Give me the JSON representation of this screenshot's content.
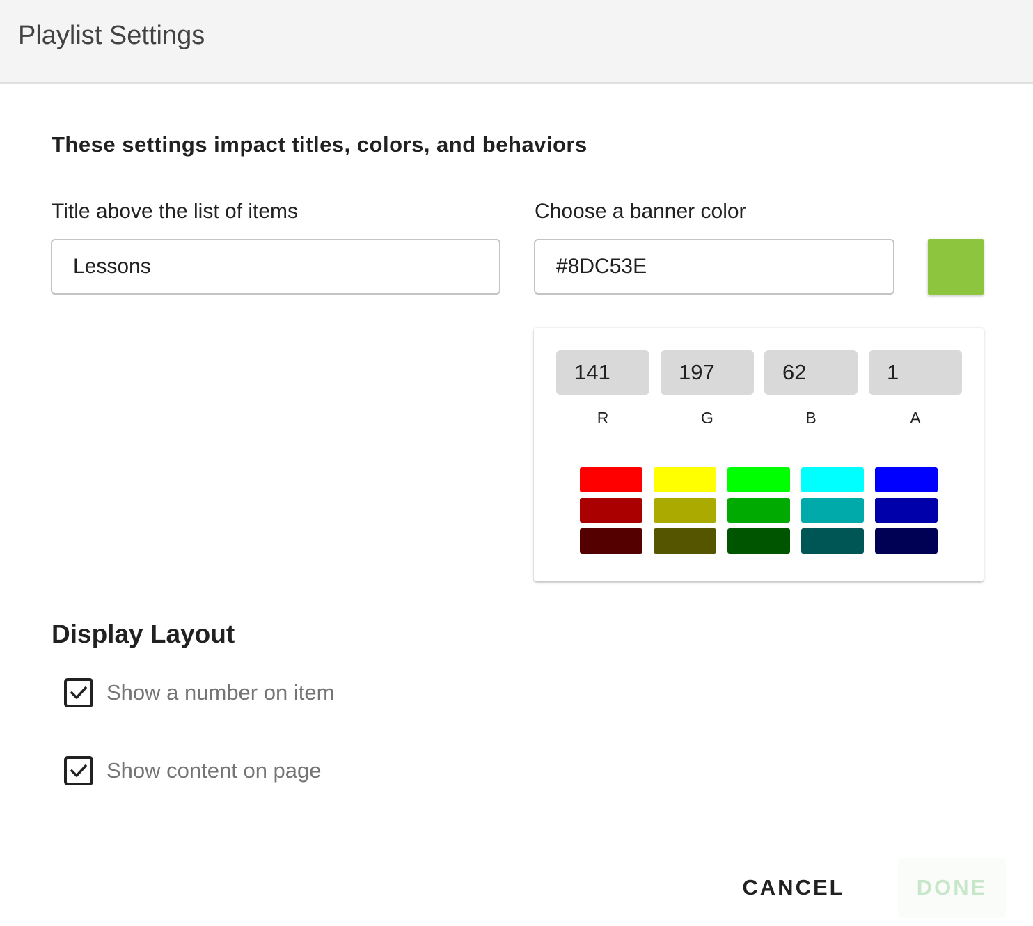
{
  "dialog": {
    "title": "Playlist Settings",
    "intro": "These settings impact titles, colors, and behaviors"
  },
  "title_field": {
    "label": "Title above the list of items",
    "value": "Lessons"
  },
  "color_field": {
    "label": "Choose a banner color",
    "value": "#8DC53E",
    "preview_color": "#8DC53E"
  },
  "picker": {
    "channels": [
      {
        "value": "141",
        "label": "R"
      },
      {
        "value": "197",
        "label": "G"
      },
      {
        "value": "62",
        "label": "B"
      },
      {
        "value": "1",
        "label": "A"
      }
    ],
    "palette": [
      [
        "#FF0000",
        "#FFFF00",
        "#00FF00",
        "#00FFFF",
        "#0000FF"
      ],
      [
        "#AA0000",
        "#AAAA00",
        "#00AA00",
        "#00AAAA",
        "#0000AA"
      ],
      [
        "#550000",
        "#555500",
        "#005500",
        "#005555",
        "#000055"
      ]
    ]
  },
  "layout_section": {
    "title": "Display Layout",
    "options": [
      {
        "label": "Show a number on item",
        "checked": true
      },
      {
        "label": "Show content on page",
        "checked": true
      }
    ]
  },
  "actions": {
    "cancel_label": "CANCEL",
    "done_label": "DONE"
  }
}
